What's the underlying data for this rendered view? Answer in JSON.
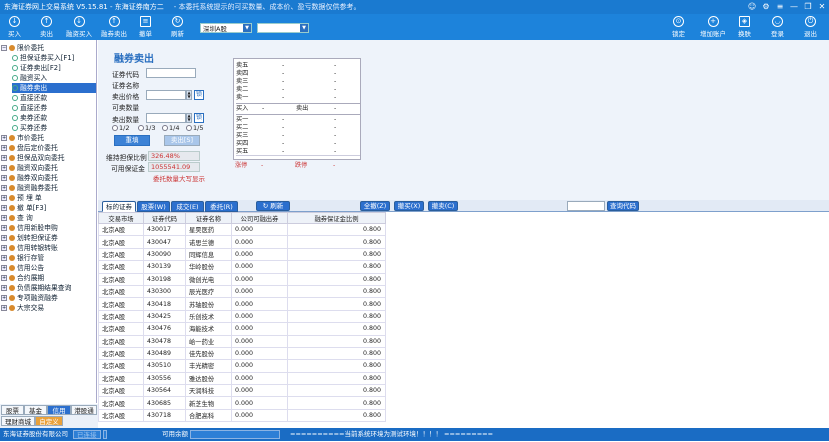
{
  "app": {
    "title": "东海证券网上交易系统 V5.15.81 - 东海证券南方二",
    "notice": "- 本委托系统提示的可买数量、成本价、盈亏数据仅供参考。",
    "window_controls": [
      "☺",
      "⚙",
      "≡",
      "—",
      "❐",
      "✕"
    ]
  },
  "toolbar": {
    "buttons": [
      "买入",
      "卖出",
      "融资买入",
      "融券卖出",
      "撤单",
      "刷新"
    ],
    "market_select": "深圳A股",
    "account_select": "",
    "right_buttons": [
      "锁定",
      "增加账户",
      "换肤",
      "登录",
      "退出"
    ]
  },
  "sidebar": {
    "items": [
      {
        "label": "限价委托",
        "marker": "⊖"
      },
      {
        "label": "担保证券买入[F1]",
        "marker": "⊕"
      },
      {
        "label": "证券卖出[F2]",
        "marker": "⊕"
      },
      {
        "label": "融资买入",
        "marker": "⊕"
      },
      {
        "label": "融券卖出",
        "marker": "⊕",
        "selected": true
      },
      {
        "label": "直接还款",
        "marker": "⊕"
      },
      {
        "label": "直接还券",
        "marker": "⊕"
      },
      {
        "label": "卖券还款",
        "marker": "⊕"
      },
      {
        "label": "买券还券",
        "marker": "⊕"
      },
      {
        "label": "市价委托",
        "marker": "⊕"
      },
      {
        "label": "盘后定价委托",
        "marker": "⊕"
      },
      {
        "label": "担保品双向委托",
        "marker": "⊕"
      },
      {
        "label": "融资双向委托",
        "marker": "⊕"
      },
      {
        "label": "融券双向委托",
        "marker": "⊕"
      },
      {
        "label": "融资融券委托",
        "marker": "⊕"
      },
      {
        "label": "预 埋 单",
        "marker": "⊕"
      },
      {
        "label": "撤    单[F3]",
        "marker": "⊕"
      },
      {
        "label": "查    询",
        "marker": "⊕"
      },
      {
        "label": "信用新股申购",
        "marker": "⊕"
      },
      {
        "label": "划转担保证券",
        "marker": "⊕"
      },
      {
        "label": "信用转银转账",
        "marker": "⊕"
      },
      {
        "label": "银行存管",
        "marker": "⊕"
      },
      {
        "label": "信用公告",
        "marker": "⊕"
      },
      {
        "label": "合约展期",
        "marker": "⊕"
      },
      {
        "label": "负债展期结果查询",
        "marker": "⊕"
      },
      {
        "label": "专项融资融券",
        "marker": "⊕"
      },
      {
        "label": "大宗交易",
        "marker": "⊕"
      }
    ],
    "bottom_tabs_row1": [
      "股票",
      "基金",
      "信用",
      "港股通"
    ],
    "bottom_tabs_row2": [
      "理财商城",
      "自定义"
    ]
  },
  "form": {
    "title": "融券卖出",
    "code_label": "证券代码",
    "code_value": "",
    "name_label": "证券名称",
    "name_value": "",
    "price_label": "卖出价格",
    "price_value": "",
    "lock_label": "锁",
    "avail_label": "可卖数量",
    "avail_value": "",
    "qty_label": "卖出数量",
    "qty_value": "",
    "ratios": [
      "1/2",
      "1/3",
      "1/4",
      "1/5"
    ],
    "reselect_button": "重填",
    "sell_button": "卖出[S]",
    "margin_ratio_label": "维持担保比例",
    "margin_ratio_value": "326.48%",
    "avail_margin_label": "可用保证金",
    "avail_margin_value": "1055541.09",
    "warning": "委托数量大写显示"
  },
  "quote": {
    "sell_rows": [
      {
        "label": "卖五",
        "price": "-",
        "vol": "-"
      },
      {
        "label": "卖四",
        "price": "-",
        "vol": "-"
      },
      {
        "label": "卖三",
        "price": "-",
        "vol": "-"
      },
      {
        "label": "卖二",
        "price": "-",
        "vol": "-"
      },
      {
        "label": "卖一",
        "price": "-",
        "vol": "-"
      }
    ],
    "mid_labels": [
      "买入",
      "-",
      "卖出",
      "-"
    ],
    "buy_rows": [
      {
        "label": "买一",
        "price": "-",
        "vol": "-"
      },
      {
        "label": "买二",
        "price": "-",
        "vol": "-"
      },
      {
        "label": "买三",
        "price": "-",
        "vol": "-"
      },
      {
        "label": "买四",
        "price": "-",
        "vol": "-"
      },
      {
        "label": "买五",
        "price": "-",
        "vol": "-"
      }
    ],
    "limit_labels": [
      "涨停",
      "-",
      "跌停",
      "-"
    ]
  },
  "tabs": {
    "items": [
      "标的证券",
      "股票(W)",
      "成交(E)",
      "委托(R)"
    ],
    "refresh": "刷新",
    "right_buttons": [
      "全撤(Z)",
      "撤买(X)",
      "撤卖(C)"
    ],
    "search_placeholder": "",
    "search_button": "查询代码"
  },
  "table": {
    "columns": [
      "交易市场",
      "证券代码",
      "证券名称",
      "公司可融出券",
      "融券保证金比例"
    ],
    "rows": [
      [
        "北京A股",
        "430017",
        "星昊医药",
        "0.000",
        "0.800"
      ],
      [
        "北京A股",
        "430047",
        "诺思兰德",
        "0.000",
        "0.800"
      ],
      [
        "北京A股",
        "430090",
        "同辉信息",
        "0.000",
        "0.800"
      ],
      [
        "北京A股",
        "430139",
        "华岭股份",
        "0.000",
        "0.800"
      ],
      [
        "北京A股",
        "430198",
        "微创光电",
        "0.000",
        "0.800"
      ],
      [
        "北京A股",
        "430300",
        "辰光医疗",
        "0.000",
        "0.800"
      ],
      [
        "北京A股",
        "430418",
        "苏轴股份",
        "0.000",
        "0.800"
      ],
      [
        "北京A股",
        "430425",
        "乐创技术",
        "0.000",
        "0.800"
      ],
      [
        "北京A股",
        "430476",
        "海能技术",
        "0.000",
        "0.800"
      ],
      [
        "北京A股",
        "430478",
        "峆一药业",
        "0.000",
        "0.800"
      ],
      [
        "北京A股",
        "430489",
        "佳先股份",
        "0.000",
        "0.800"
      ],
      [
        "北京A股",
        "430510",
        "丰光精密",
        "0.000",
        "0.800"
      ],
      [
        "北京A股",
        "430556",
        "雅达股份",
        "0.000",
        "0.800"
      ],
      [
        "北京A股",
        "430564",
        "天润科技",
        "0.000",
        "0.800"
      ],
      [
        "北京A股",
        "430685",
        "新芝生物",
        "0.000",
        "0.800"
      ],
      [
        "北京A股",
        "430718",
        "合肥高科",
        "0.000",
        "0.800"
      ]
    ]
  },
  "statusbar": {
    "broker": "东海证券股份有限公司",
    "label1": "已连接",
    "label2": "可用余额",
    "message": "==========当前系统环境为测试环境！！！！ ========="
  }
}
